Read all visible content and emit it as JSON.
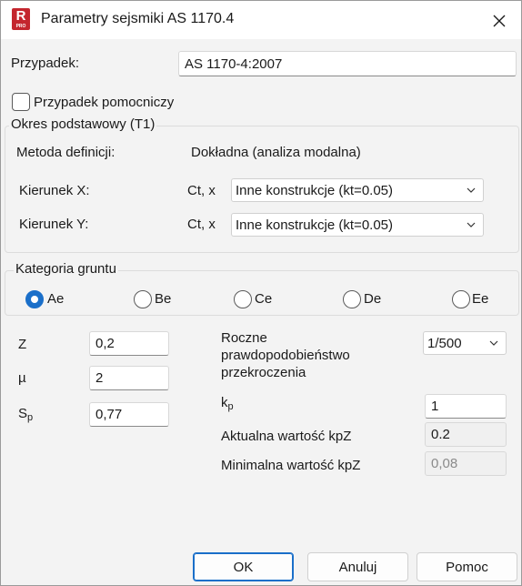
{
  "window": {
    "title": "Parametry sejsmiki AS 1170.4",
    "icon": "revit-pro-icon"
  },
  "case": {
    "label": "Przypadek:",
    "value": "AS 1170-4:2007"
  },
  "auxiliary_case": {
    "label": "Przypadek pomocniczy",
    "checked": false
  },
  "base_period": {
    "title": "Okres podstawowy (T1)",
    "method_label": "Metoda definicji:",
    "method_value": "Dokładna (analiza modalna)",
    "dir_x_label": "Kierunek X:",
    "dir_x_ct": "Ct, x",
    "dir_x_value": "Inne konstrukcje (kt=0.05)",
    "dir_y_label": "Kierunek Y:",
    "dir_y_ct": "Ct, x",
    "dir_y_value": "Inne konstrukcje (kt=0.05)"
  },
  "soil": {
    "title": "Kategoria gruntu",
    "options": [
      "Ae",
      "Be",
      "Ce",
      "De",
      "Ee"
    ],
    "selected": "Ae"
  },
  "params": {
    "z_label": "Z",
    "z_value": "0,2",
    "mu_label": "µ",
    "mu_value": "2",
    "sp_label_main": "S",
    "sp_label_sub": "p",
    "sp_value": "0,77"
  },
  "right": {
    "prob_label_1": "Roczne",
    "prob_label_2": "prawdopodobieństwo",
    "prob_label_3": "przekroczenia",
    "prob_value": "1/500",
    "kp_label_main": "k",
    "kp_label_sub": "p",
    "kp_value": "1",
    "current_label": "Aktualna wartość kpZ",
    "current_value": "0.2",
    "min_label": "Minimalna wartość kpZ",
    "min_value": "0,08"
  },
  "buttons": {
    "ok": "OK",
    "cancel": "Anuluj",
    "help": "Pomoc"
  },
  "colors": {
    "accent": "#1a6fc9",
    "app_icon": "#c4262e"
  }
}
